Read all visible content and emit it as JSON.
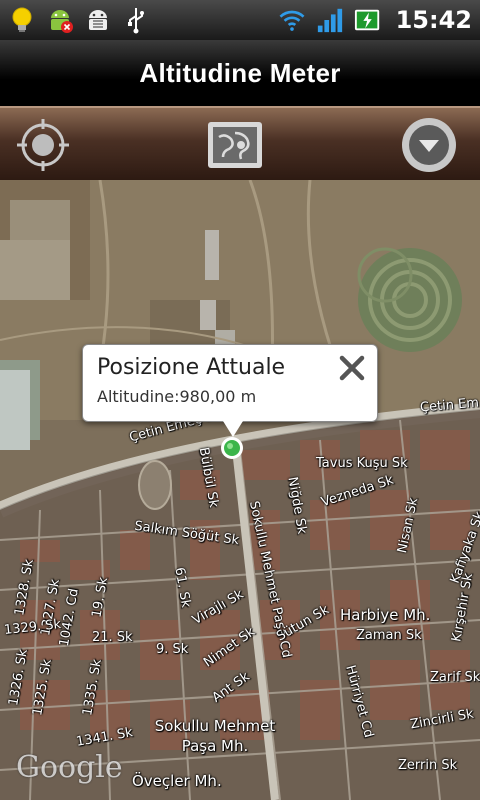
{
  "status_bar": {
    "time": "15:42",
    "left_icons": [
      "lightbulb-icon",
      "android-update-icon",
      "android-debug-icon",
      "usb-icon"
    ],
    "right_icons": [
      "wifi-icon",
      "signal-icon",
      "battery-charging-icon"
    ]
  },
  "title_bar": {
    "title": "Altitudine Meter"
  },
  "toolbar": {
    "buttons": [
      "locate-icon",
      "map-view-icon",
      "menu-down-icon"
    ]
  },
  "map": {
    "popup": {
      "title": "Posizione Attuale",
      "subtitle": "Altitudine:980,00 m"
    },
    "streets": [
      "Çetin Emeç Blv",
      "Çetin Emeç Blv",
      "Çetin Em",
      "Tavus Kuşu Sk",
      "Vezneda Sk",
      "Bülbül Sk",
      "Salkım Söğüt Sk",
      "Sokullu Mehmet Paşa Cd",
      "Niğde Sk",
      "Nisan Sk",
      "Kafiyaka Sk",
      "Kırşehir Sk",
      "1328. Sk",
      "1327. Sk",
      "1329. Sk",
      "1326. Sk",
      "1325. Sk",
      "1042. Cd",
      "19. Sk",
      "21. Sk",
      "9. Sk",
      "61. Sk",
      "Virajlı Sk",
      "Nimet Sk",
      "Sütun Sk",
      "Ant Sk",
      "Hürriyet Cd",
      "Zaman Sk",
      "Zarif Sk",
      "Zincirli Sk",
      "Zerrin Sk",
      "1335. Sk",
      "1341. Sk"
    ],
    "districts": [
      "Harbiye Mh.",
      "Sokullu Mehmet Paşa Mh.",
      "Öveçler Mh."
    ],
    "attribution": "Google"
  },
  "colors": {
    "toolbar_top": "#8b6a53",
    "toolbar_bottom": "#2d1a12",
    "marker_green": "#3bb54a"
  }
}
